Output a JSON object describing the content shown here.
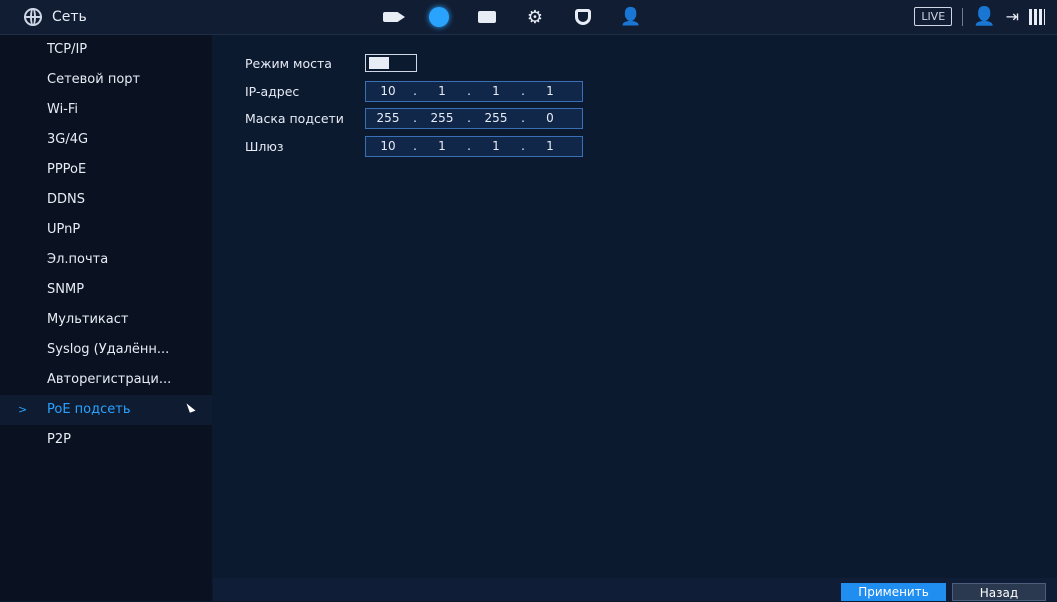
{
  "header": {
    "title": "Сеть",
    "live_label": "LIVE",
    "nav_icons": [
      "camera-icon",
      "network-icon",
      "storage-icon",
      "settings-icon",
      "security-icon",
      "account-icon"
    ]
  },
  "sidebar": {
    "items": [
      {
        "label": "TCP/IP"
      },
      {
        "label": "Сетевой порт"
      },
      {
        "label": "Wi-Fi"
      },
      {
        "label": "3G/4G"
      },
      {
        "label": "PPPoE"
      },
      {
        "label": "DDNS"
      },
      {
        "label": "UPnP"
      },
      {
        "label": "Эл.почта"
      },
      {
        "label": "SNMP"
      },
      {
        "label": "Мультикаст"
      },
      {
        "label": "Syslog (Удалённ..."
      },
      {
        "label": "Авторегистраци..."
      },
      {
        "label": "PoE подсеть",
        "active": true
      },
      {
        "label": "P2P"
      }
    ]
  },
  "form": {
    "bridge_mode_label": "Режим моста",
    "ip_label": "IP-адрес",
    "ip": [
      "10",
      "1",
      "1",
      "1"
    ],
    "mask_label": "Маска подсети",
    "mask": [
      "255",
      "255",
      "255",
      "0"
    ],
    "gateway_label": "Шлюз",
    "gateway": [
      "10",
      "1",
      "1",
      "1"
    ]
  },
  "buttons": {
    "apply": "Применить",
    "back": "Назад"
  },
  "colors": {
    "accent": "#2aa3ff",
    "background": "#0c1a30",
    "sidebar": "#0a1222"
  }
}
